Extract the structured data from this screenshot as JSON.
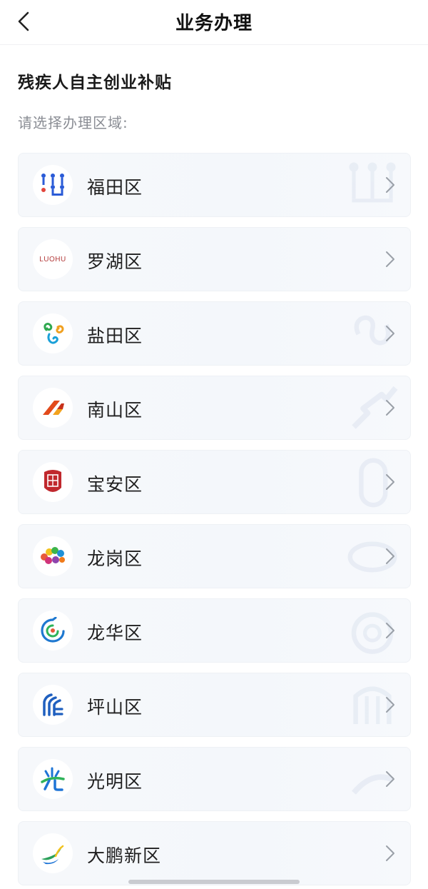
{
  "navbar": {
    "title": "业务办理"
  },
  "section": {
    "title": "残疾人自主创业补贴",
    "subtitle": "请选择办理区域:"
  },
  "districts": [
    {
      "label": "福田区",
      "logo_icon": "futian-logo-icon",
      "accent": "#2a5bd7"
    },
    {
      "label": "罗湖区",
      "logo_icon": "luohu-logo-icon",
      "logo_text": "LUOHU",
      "accent": "#b33a3a"
    },
    {
      "label": "盐田区",
      "logo_icon": "yantian-logo-icon",
      "accent": "#1aa0d8"
    },
    {
      "label": "南山区",
      "logo_icon": "nanshan-logo-icon",
      "accent": "#e24a1b"
    },
    {
      "label": "宝安区",
      "logo_icon": "baoan-logo-icon",
      "accent": "#c0282d"
    },
    {
      "label": "龙岗区",
      "logo_icon": "longgang-logo-icon",
      "accent": "#e8593a"
    },
    {
      "label": "龙华区",
      "logo_icon": "longhua-logo-icon",
      "accent": "#1e78d0"
    },
    {
      "label": "坪山区",
      "logo_icon": "pingshan-logo-icon",
      "accent": "#1f5fbf"
    },
    {
      "label": "光明区",
      "logo_icon": "guangming-logo-icon",
      "accent": "#1e74d6"
    },
    {
      "label": "大鹏新区",
      "logo_icon": "dapeng-logo-icon",
      "accent": "#2aa05a"
    }
  ]
}
